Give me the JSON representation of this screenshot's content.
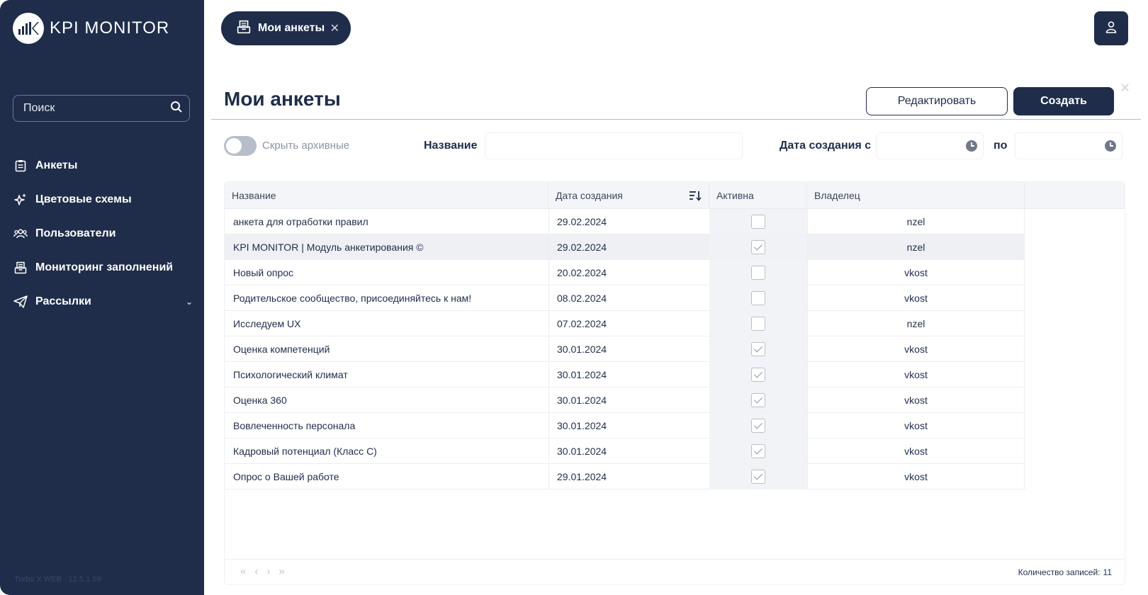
{
  "app": {
    "logo_text": "KPI MONITOR",
    "version": "Turbo X WEB · 12.5.1.59"
  },
  "search": {
    "placeholder": "Поиск"
  },
  "sidebar": {
    "items": [
      {
        "label": "Анкеты",
        "icon": "clipboard-icon"
      },
      {
        "label": "Цветовые схемы",
        "icon": "sparkle-star-icon"
      },
      {
        "label": "Пользователи",
        "icon": "users-icon"
      },
      {
        "label": "Мониторинг заполнений",
        "icon": "inbox-icon"
      },
      {
        "label": "Рассылки",
        "icon": "paper-plane-icon",
        "has_submenu": true
      }
    ]
  },
  "tabs": [
    {
      "label": "Мои анкеты",
      "icon": "inbox-icon",
      "closable": true
    }
  ],
  "header": {
    "title": "Мои анкеты",
    "edit_label": "Редактировать",
    "create_label": "Создать",
    "close": "✕"
  },
  "filters": {
    "hide_archived_label": "Скрыть архивные",
    "hide_archived": false,
    "name_label": "Название",
    "name_value": "",
    "date_from_label": "Дата создания с",
    "date_to_label": "по"
  },
  "table": {
    "columns": [
      "Название",
      "Дата создания",
      "Активна",
      "Владелец"
    ],
    "sort_icon": "sort-descending-icon",
    "rows": [
      {
        "name": "анкета для отработки правил",
        "date": "29.02.2024",
        "active": false,
        "owner": "nzel"
      },
      {
        "name": "KPI MONITOR | Модуль анкетирования ©",
        "date": "29.02.2024",
        "active": true,
        "owner": "nzel",
        "selected": true
      },
      {
        "name": "Новый опрос",
        "date": "20.02.2024",
        "active": false,
        "owner": "vkost"
      },
      {
        "name": "Родительское сообщество, присоединяйтесь к нам!",
        "date": "08.02.2024",
        "active": false,
        "owner": "vkost"
      },
      {
        "name": "Исследуем UX",
        "date": "07.02.2024",
        "active": false,
        "owner": "nzel"
      },
      {
        "name": "Оценка компетенций",
        "date": "30.01.2024",
        "active": true,
        "owner": "vkost"
      },
      {
        "name": "Психологический климат",
        "date": "30.01.2024",
        "active": true,
        "owner": "vkost"
      },
      {
        "name": "Оценка 360",
        "date": "30.01.2024",
        "active": true,
        "owner": "vkost"
      },
      {
        "name": "Вовлеченность персонала",
        "date": "30.01.2024",
        "active": true,
        "owner": "vkost"
      },
      {
        "name": "Кадровый потенциал (Класс С)",
        "date": "30.01.2024",
        "active": true,
        "owner": "vkost"
      },
      {
        "name": "Опрос о Вашей работе",
        "date": "29.01.2024",
        "active": true,
        "owner": "vkost"
      }
    ],
    "pager": {
      "first": "«",
      "prev": "‹",
      "next": "›",
      "last": "»"
    },
    "count_label": "Количество записей:",
    "count_value": "11"
  },
  "colors": {
    "sidebar_bg": "#1f2d4a",
    "accent": "#1f2d4a",
    "muted": "#8b94a3"
  }
}
